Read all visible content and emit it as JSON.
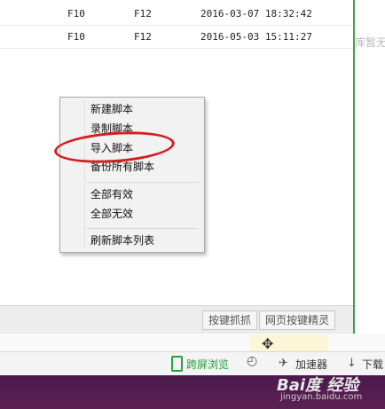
{
  "table": {
    "rows": [
      {
        "hotkey_start": "F10",
        "hotkey_stop": "F12",
        "datetime": "2016-03-07 18:32:42"
      },
      {
        "hotkey_start": "F10",
        "hotkey_stop": "F12",
        "datetime": "2016-05-03 15:11:27"
      }
    ]
  },
  "side_panel": {
    "text": "库暂无"
  },
  "context_menu": {
    "items": [
      "新建脚本",
      "录制脚本",
      "导入脚本",
      "备份所有脚本",
      "全部有效",
      "全部无效",
      "刷新脚本列表"
    ],
    "highlighted": "导入脚本"
  },
  "panel_toolbar": {
    "capture_label": "按键抓抓",
    "wizard_label": "网页按键精灵"
  },
  "status_bar": {
    "split_view_label": "跨屏浏览",
    "accelerator_label": "加速器",
    "download_label": "下载"
  },
  "icons": {
    "move": "move-arrows-icon",
    "phone": "phone-icon",
    "clock": "clock-icon",
    "rocket": "rocket-icon",
    "download": "download-arrow-icon"
  },
  "watermark": {
    "logo": "Bai度 经验",
    "url": "jingyan.baidu.com"
  },
  "colors": {
    "accent_green": "#3fa34d",
    "highlight_red": "#d0201f",
    "desktop_purple": "#4a1a4b"
  }
}
